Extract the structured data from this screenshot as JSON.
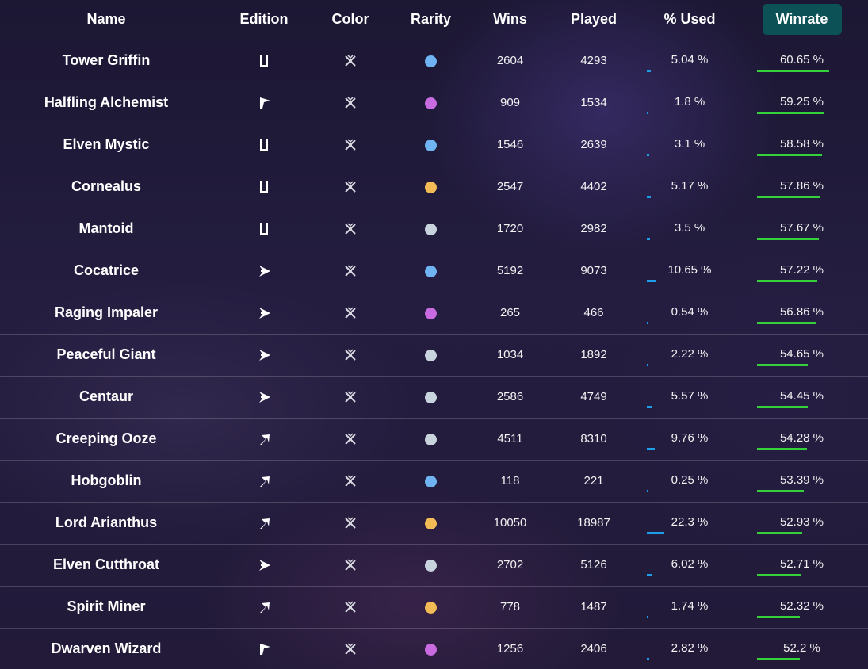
{
  "colors": {
    "common": "#c9d3de",
    "rare": "#6fb3f2",
    "epic": "#c86be0",
    "legendary": "#f2bb55",
    "used_bar": "#1e9ee8",
    "winrate_bar": "#33d23a",
    "winrate_header_bg": "#0b5156"
  },
  "headers": {
    "name": "Name",
    "edition": "Edition",
    "color": "Color",
    "rarity": "Rarity",
    "wins": "Wins",
    "played": "Played",
    "used": "% Used",
    "winrate": "Winrate"
  },
  "rows": [
    {
      "name": "Tower Griffin",
      "edition": "alpha",
      "color": "neutral",
      "rarity": "rare",
      "wins": "2604",
      "played": "4293",
      "used": "5.04 %",
      "used_value": 5.04,
      "winrate": "60.65 %",
      "winrate_value": 60.65
    },
    {
      "name": "Halfling Alchemist",
      "edition": "untamed",
      "color": "neutral",
      "rarity": "epic",
      "wins": "909",
      "played": "1534",
      "used": "1.8 %",
      "used_value": 1.8,
      "winrate": "59.25 %",
      "winrate_value": 59.25
    },
    {
      "name": "Elven Mystic",
      "edition": "alpha",
      "color": "neutral",
      "rarity": "rare",
      "wins": "1546",
      "played": "2639",
      "used": "3.1 %",
      "used_value": 3.1,
      "winrate": "58.58 %",
      "winrate_value": 58.58
    },
    {
      "name": "Cornealus",
      "edition": "alpha",
      "color": "neutral",
      "rarity": "legendary",
      "wins": "2547",
      "played": "4402",
      "used": "5.17 %",
      "used_value": 5.17,
      "winrate": "57.86 %",
      "winrate_value": 57.86
    },
    {
      "name": "Mantoid",
      "edition": "alpha",
      "color": "neutral",
      "rarity": "common",
      "wins": "1720",
      "played": "2982",
      "used": "3.5 %",
      "used_value": 3.5,
      "winrate": "57.67 %",
      "winrate_value": 57.67
    },
    {
      "name": "Cocatrice",
      "edition": "chaos",
      "color": "neutral",
      "rarity": "rare",
      "wins": "5192",
      "played": "9073",
      "used": "10.65 %",
      "used_value": 10.65,
      "winrate": "57.22 %",
      "winrate_value": 57.22
    },
    {
      "name": "Raging Impaler",
      "edition": "chaos",
      "color": "neutral",
      "rarity": "epic",
      "wins": "265",
      "played": "466",
      "used": "0.54 %",
      "used_value": 0.54,
      "winrate": "56.86 %",
      "winrate_value": 56.86
    },
    {
      "name": "Peaceful Giant",
      "edition": "chaos",
      "color": "neutral",
      "rarity": "common",
      "wins": "1034",
      "played": "1892",
      "used": "2.22 %",
      "used_value": 2.22,
      "winrate": "54.65 %",
      "winrate_value": 54.65
    },
    {
      "name": "Centaur",
      "edition": "chaos",
      "color": "neutral",
      "rarity": "common",
      "wins": "2586",
      "played": "4749",
      "used": "5.57 %",
      "used_value": 5.57,
      "winrate": "54.45 %",
      "winrate_value": 54.45
    },
    {
      "name": "Creeping Ooze",
      "edition": "reward",
      "color": "neutral",
      "rarity": "common",
      "wins": "4511",
      "played": "8310",
      "used": "9.76 %",
      "used_value": 9.76,
      "winrate": "54.28 %",
      "winrate_value": 54.28
    },
    {
      "name": "Hobgoblin",
      "edition": "reward",
      "color": "neutral",
      "rarity": "rare",
      "wins": "118",
      "played": "221",
      "used": "0.25 %",
      "used_value": 0.25,
      "winrate": "53.39 %",
      "winrate_value": 53.39
    },
    {
      "name": "Lord Arianthus",
      "edition": "reward",
      "color": "neutral",
      "rarity": "legendary",
      "wins": "10050",
      "played": "18987",
      "used": "22.3 %",
      "used_value": 22.3,
      "winrate": "52.93 %",
      "winrate_value": 52.93
    },
    {
      "name": "Elven Cutthroat",
      "edition": "chaos",
      "color": "neutral",
      "rarity": "common",
      "wins": "2702",
      "played": "5126",
      "used": "6.02 %",
      "used_value": 6.02,
      "winrate": "52.71 %",
      "winrate_value": 52.71
    },
    {
      "name": "Spirit Miner",
      "edition": "reward",
      "color": "neutral",
      "rarity": "legendary",
      "wins": "778",
      "played": "1487",
      "used": "1.74 %",
      "used_value": 1.74,
      "winrate": "52.32 %",
      "winrate_value": 52.32
    },
    {
      "name": "Dwarven Wizard",
      "edition": "untamed",
      "color": "neutral",
      "rarity": "epic",
      "wins": "1256",
      "played": "2406",
      "used": "2.82 %",
      "used_value": 2.82,
      "winrate": "52.2 %",
      "winrate_value": 52.2
    }
  ]
}
